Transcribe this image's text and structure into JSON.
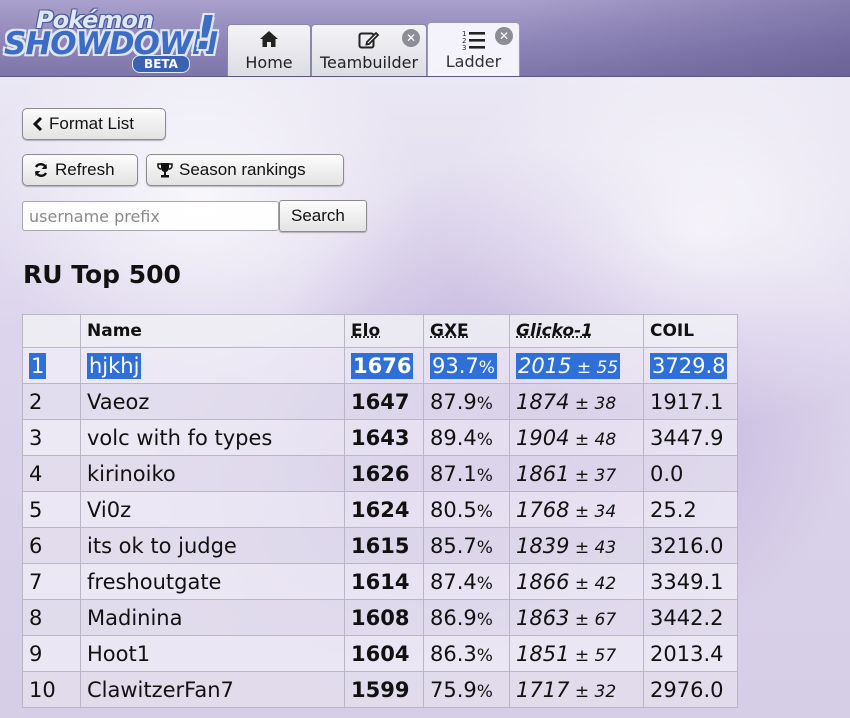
{
  "header": {
    "logo": {
      "line1": "Pokémon",
      "line2": "SHOWDOWN",
      "bang": "!",
      "badge": "BETA"
    },
    "tabs": [
      {
        "label": "Home",
        "icon": "home-icon",
        "closable": false
      },
      {
        "label": "Teambuilder",
        "icon": "edit-icon",
        "closable": true
      },
      {
        "label": "Ladder",
        "icon": "list-ordered-icon",
        "closable": true,
        "active": true
      }
    ],
    "close_glyph": "✕"
  },
  "toolbar": {
    "format_list": "Format List",
    "refresh": "Refresh",
    "season_rankings": "Season rankings",
    "search_button": "Search",
    "search_placeholder": "username prefix"
  },
  "ladder": {
    "title": "RU Top 500",
    "columns": [
      "",
      "Name",
      "Elo",
      "GXE",
      "Glicko-1",
      "COIL"
    ],
    "rows": [
      {
        "rank": "1",
        "name": "hjkhj",
        "elo": "1676",
        "gxe": "93.7",
        "glicko": "2015",
        "dev": "55",
        "coil": "3729.8"
      },
      {
        "rank": "2",
        "name": "Vaeoz",
        "elo": "1647",
        "gxe": "87.9",
        "glicko": "1874",
        "dev": "38",
        "coil": "1917.1"
      },
      {
        "rank": "3",
        "name": "volc with fo types",
        "elo": "1643",
        "gxe": "89.4",
        "glicko": "1904",
        "dev": "48",
        "coil": "3447.9"
      },
      {
        "rank": "4",
        "name": "kirinoiko",
        "elo": "1626",
        "gxe": "87.1",
        "glicko": "1861",
        "dev": "37",
        "coil": "0.0"
      },
      {
        "rank": "5",
        "name": "Vi0z",
        "elo": "1624",
        "gxe": "80.5",
        "glicko": "1768",
        "dev": "34",
        "coil": "25.2"
      },
      {
        "rank": "6",
        "name": "its ok to judge",
        "elo": "1615",
        "gxe": "85.7",
        "glicko": "1839",
        "dev": "43",
        "coil": "3216.0"
      },
      {
        "rank": "7",
        "name": "freshoutgate",
        "elo": "1614",
        "gxe": "87.4",
        "glicko": "1866",
        "dev": "42",
        "coil": "3349.1"
      },
      {
        "rank": "8",
        "name": "Madinina",
        "elo": "1608",
        "gxe": "86.9",
        "glicko": "1863",
        "dev": "67",
        "coil": "3442.2"
      },
      {
        "rank": "9",
        "name": "Hoot1",
        "elo": "1604",
        "gxe": "86.3",
        "glicko": "1851",
        "dev": "57",
        "coil": "2013.4"
      },
      {
        "rank": "10",
        "name": "ClawitzerFan7",
        "elo": "1599",
        "gxe": "75.9",
        "glicko": "1717",
        "dev": "32",
        "coil": "2976.0"
      }
    ],
    "selected_row": 0
  },
  "colors": {
    "selection": "#2f6fd8",
    "logo_blue": "#3d6cc4"
  }
}
